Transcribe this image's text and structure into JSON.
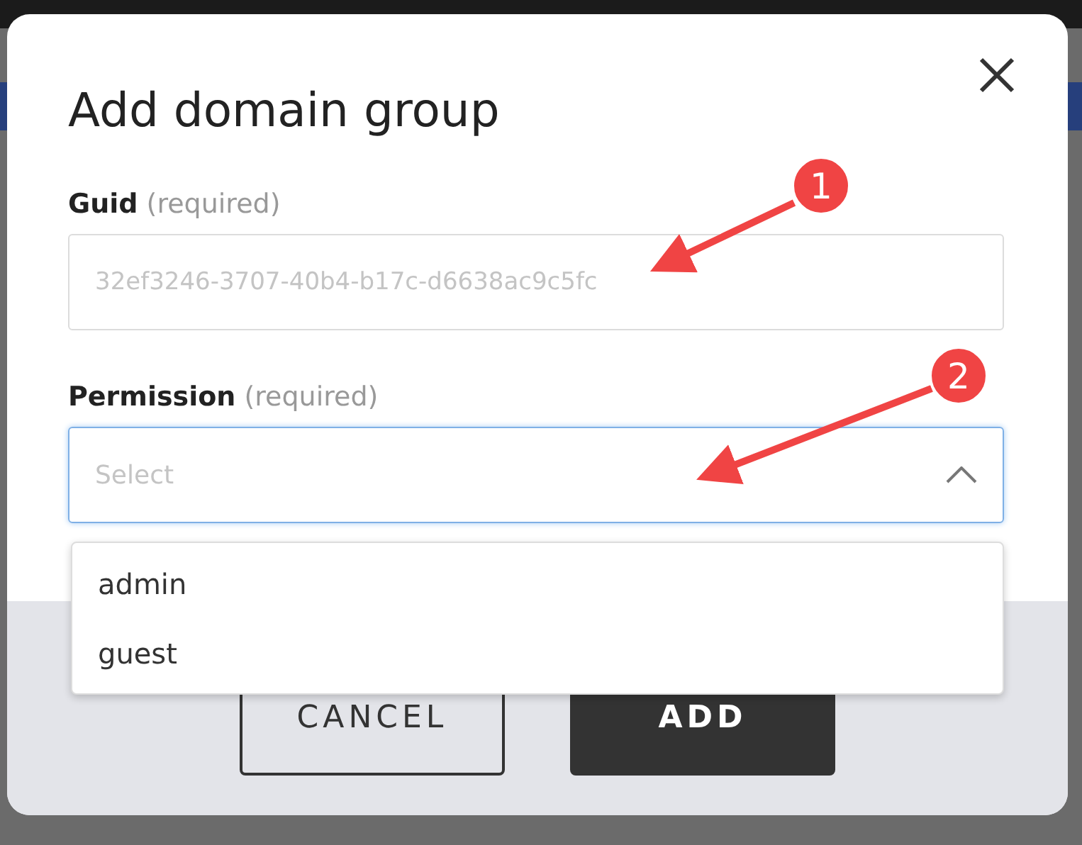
{
  "dialog": {
    "title": "Add domain group",
    "fields": [
      {
        "kind": "text",
        "label": "Guid",
        "hint": "(required)",
        "placeholder": "32ef3246-3707-40b4-b17c-d6638ac9c5fc"
      },
      {
        "kind": "select",
        "label": "Permission",
        "hint": "(required)",
        "placeholder": "Select",
        "expanded": true,
        "options": [
          {
            "label": "admin",
            "selected": false
          },
          {
            "label": "guest",
            "selected": false
          }
        ]
      }
    ],
    "buttons": [
      {
        "label": "CANCEL",
        "kind": "secondary"
      },
      {
        "label": "ADD",
        "kind": "primary"
      }
    ]
  },
  "annotations": [
    {
      "number": "1"
    },
    {
      "number": "2"
    }
  ]
}
